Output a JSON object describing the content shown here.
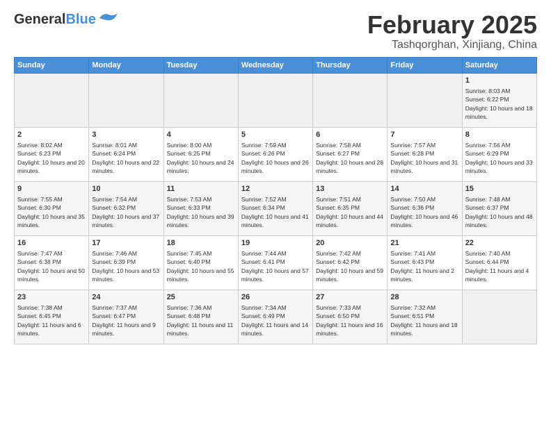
{
  "header": {
    "logo_general": "General",
    "logo_blue": "Blue",
    "main_title": "February 2025",
    "sub_title": "Tashqorghan, Xinjiang, China"
  },
  "days_of_week": [
    "Sunday",
    "Monday",
    "Tuesday",
    "Wednesday",
    "Thursday",
    "Friday",
    "Saturday"
  ],
  "weeks": [
    [
      {
        "day": "",
        "info": ""
      },
      {
        "day": "",
        "info": ""
      },
      {
        "day": "",
        "info": ""
      },
      {
        "day": "",
        "info": ""
      },
      {
        "day": "",
        "info": ""
      },
      {
        "day": "",
        "info": ""
      },
      {
        "day": "1",
        "info": "Sunrise: 8:03 AM\nSunset: 6:22 PM\nDaylight: 10 hours and 18 minutes."
      }
    ],
    [
      {
        "day": "2",
        "info": "Sunrise: 8:02 AM\nSunset: 6:23 PM\nDaylight: 10 hours and 20 minutes."
      },
      {
        "day": "3",
        "info": "Sunrise: 8:01 AM\nSunset: 6:24 PM\nDaylight: 10 hours and 22 minutes."
      },
      {
        "day": "4",
        "info": "Sunrise: 8:00 AM\nSunset: 6:25 PM\nDaylight: 10 hours and 24 minutes."
      },
      {
        "day": "5",
        "info": "Sunrise: 7:59 AM\nSunset: 6:26 PM\nDaylight: 10 hours and 26 minutes."
      },
      {
        "day": "6",
        "info": "Sunrise: 7:58 AM\nSunset: 6:27 PM\nDaylight: 10 hours and 28 minutes."
      },
      {
        "day": "7",
        "info": "Sunrise: 7:57 AM\nSunset: 6:28 PM\nDaylight: 10 hours and 31 minutes."
      },
      {
        "day": "8",
        "info": "Sunrise: 7:56 AM\nSunset: 6:29 PM\nDaylight: 10 hours and 33 minutes."
      }
    ],
    [
      {
        "day": "9",
        "info": "Sunrise: 7:55 AM\nSunset: 6:30 PM\nDaylight: 10 hours and 35 minutes."
      },
      {
        "day": "10",
        "info": "Sunrise: 7:54 AM\nSunset: 6:32 PM\nDaylight: 10 hours and 37 minutes."
      },
      {
        "day": "11",
        "info": "Sunrise: 7:53 AM\nSunset: 6:33 PM\nDaylight: 10 hours and 39 minutes."
      },
      {
        "day": "12",
        "info": "Sunrise: 7:52 AM\nSunset: 6:34 PM\nDaylight: 10 hours and 41 minutes."
      },
      {
        "day": "13",
        "info": "Sunrise: 7:51 AM\nSunset: 6:35 PM\nDaylight: 10 hours and 44 minutes."
      },
      {
        "day": "14",
        "info": "Sunrise: 7:50 AM\nSunset: 6:36 PM\nDaylight: 10 hours and 46 minutes."
      },
      {
        "day": "15",
        "info": "Sunrise: 7:48 AM\nSunset: 6:37 PM\nDaylight: 10 hours and 48 minutes."
      }
    ],
    [
      {
        "day": "16",
        "info": "Sunrise: 7:47 AM\nSunset: 6:38 PM\nDaylight: 10 hours and 50 minutes."
      },
      {
        "day": "17",
        "info": "Sunrise: 7:46 AM\nSunset: 6:39 PM\nDaylight: 10 hours and 53 minutes."
      },
      {
        "day": "18",
        "info": "Sunrise: 7:45 AM\nSunset: 6:40 PM\nDaylight: 10 hours and 55 minutes."
      },
      {
        "day": "19",
        "info": "Sunrise: 7:44 AM\nSunset: 6:41 PM\nDaylight: 10 hours and 57 minutes."
      },
      {
        "day": "20",
        "info": "Sunrise: 7:42 AM\nSunset: 6:42 PM\nDaylight: 10 hours and 59 minutes."
      },
      {
        "day": "21",
        "info": "Sunrise: 7:41 AM\nSunset: 6:43 PM\nDaylight: 11 hours and 2 minutes."
      },
      {
        "day": "22",
        "info": "Sunrise: 7:40 AM\nSunset: 6:44 PM\nDaylight: 11 hours and 4 minutes."
      }
    ],
    [
      {
        "day": "23",
        "info": "Sunrise: 7:38 AM\nSunset: 6:45 PM\nDaylight: 11 hours and 6 minutes."
      },
      {
        "day": "24",
        "info": "Sunrise: 7:37 AM\nSunset: 6:47 PM\nDaylight: 11 hours and 9 minutes."
      },
      {
        "day": "25",
        "info": "Sunrise: 7:36 AM\nSunset: 6:48 PM\nDaylight: 11 hours and 11 minutes."
      },
      {
        "day": "26",
        "info": "Sunrise: 7:34 AM\nSunset: 6:49 PM\nDaylight: 11 hours and 14 minutes."
      },
      {
        "day": "27",
        "info": "Sunrise: 7:33 AM\nSunset: 6:50 PM\nDaylight: 11 hours and 16 minutes."
      },
      {
        "day": "28",
        "info": "Sunrise: 7:32 AM\nSunset: 6:51 PM\nDaylight: 11 hours and 18 minutes."
      },
      {
        "day": "",
        "info": ""
      }
    ]
  ]
}
